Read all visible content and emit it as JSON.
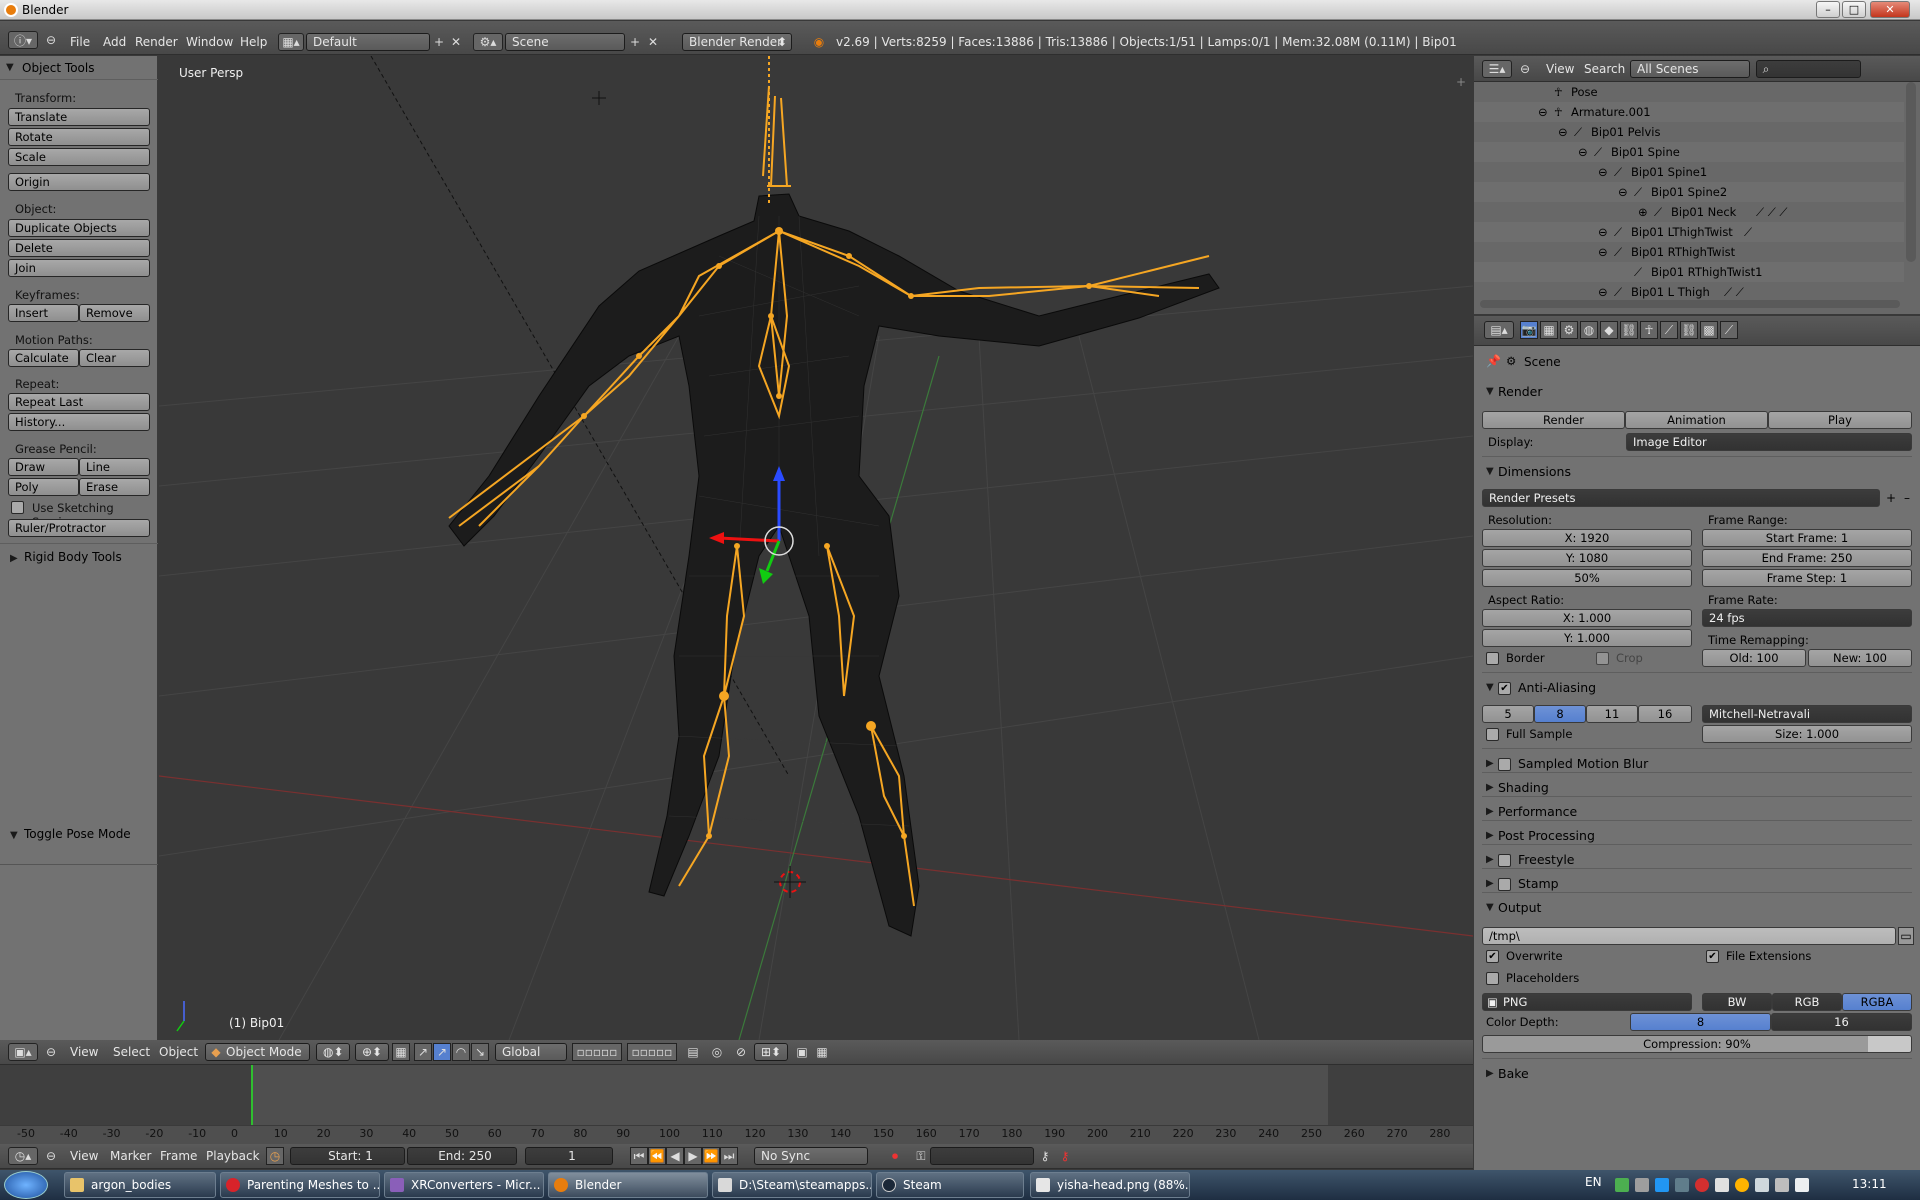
{
  "window": {
    "title": "Blender"
  },
  "info_header": {
    "menus": [
      "File",
      "Add",
      "Render",
      "Window",
      "Help"
    ],
    "screen_layout": "Default",
    "scene": "Scene",
    "render_engine": "Blender Render",
    "stats": "v2.69 | Verts:8259 | Faces:13886 | Tris:13886 | Objects:1/51 | Lamps:0/1 | Mem:32.08M (0.11M) | Bip01"
  },
  "tool_shelf": {
    "title": "Object Tools",
    "transform_label": "Transform:",
    "translate": "Translate",
    "rotate": "Rotate",
    "scale": "Scale",
    "origin": "Origin",
    "object_label": "Object:",
    "duplicate": "Duplicate Objects",
    "delete": "Delete",
    "join": "Join",
    "keyframes_label": "Keyframes:",
    "insert": "Insert",
    "remove": "Remove",
    "motion_paths_label": "Motion Paths:",
    "calculate": "Calculate",
    "clear": "Clear",
    "repeat_label": "Repeat:",
    "repeat_last": "Repeat Last",
    "history": "History...",
    "grease_label": "Grease Pencil:",
    "draw": "Draw",
    "line": "Line",
    "poly": "Poly",
    "erase": "Erase",
    "sketching": "Use Sketching Sessions",
    "ruler": "Ruler/Protractor",
    "rigid_body": "Rigid Body Tools",
    "toggle_pose": "Toggle Pose Mode"
  },
  "viewport": {
    "label": "User Persp",
    "active_object": "(1) Bip01"
  },
  "view3d_header": {
    "menus": [
      "View",
      "Select",
      "Object"
    ],
    "mode": "Object Mode",
    "orientation": "Global"
  },
  "outliner": {
    "menus": [
      "View",
      "Search"
    ],
    "filter": "All Scenes",
    "rows": [
      "Pose",
      "Armature.001",
      "Bip01 Pelvis",
      "Bip01 Spine",
      "Bip01 Spine1",
      "Bip01 Spine2",
      "Bip01 Neck",
      "Bip01 LThighTwist",
      "Bip01 RThighTwist",
      "Bip01 RThighTwist1",
      "Bip01 L Thigh"
    ]
  },
  "properties": {
    "context": "Scene",
    "render_panel": "Render",
    "render_btn": "Render",
    "animation_btn": "Animation",
    "play_btn": "Play",
    "display_label": "Display:",
    "display_value": "Image Editor",
    "dimensions": "Dimensions",
    "render_presets": "Render Presets",
    "resolution_label": "Resolution:",
    "res_x": "X: 1920",
    "res_y": "Y: 1080",
    "res_pct": "50%",
    "frame_range_label": "Frame Range:",
    "start_frame": "Start Frame: 1",
    "end_frame": "End Frame: 250",
    "frame_step": "Frame Step: 1",
    "aspect_label": "Aspect Ratio:",
    "aspect_x": "X: 1.000",
    "aspect_y": "Y: 1.000",
    "frame_rate_label": "Frame Rate:",
    "frame_rate": "24 fps",
    "time_remap_label": "Time Remapping:",
    "old": "Old: 100",
    "new": "New: 100",
    "border": "Border",
    "crop": "Crop",
    "anti_aliasing": "Anti-Aliasing",
    "aa_samples": [
      "5",
      "8",
      "11",
      "16"
    ],
    "aa_filter": "Mitchell-Netravali",
    "full_sample": "Full Sample",
    "size": "Size: 1.000",
    "collapsed": [
      "Sampled Motion Blur",
      "Shading",
      "Performance",
      "Post Processing",
      "Freestyle",
      "Stamp"
    ],
    "output": "Output",
    "output_path": "/tmp\\",
    "overwrite": "Overwrite",
    "file_ext": "File Extensions",
    "placeholders": "Placeholders",
    "format": "PNG",
    "bw": "BW",
    "rgb": "RGB",
    "rgba": "RGBA",
    "color_depth_label": "Color Depth:",
    "depth_8": "8",
    "depth_16": "16",
    "compression": "Compression: 90%",
    "bake": "Bake"
  },
  "timeline": {
    "ticks": [
      "-50",
      "-40",
      "-30",
      "-20",
      "-10",
      "0",
      "10",
      "20",
      "30",
      "40",
      "50",
      "60",
      "70",
      "80",
      "90",
      "100",
      "110",
      "120",
      "130",
      "140",
      "150",
      "160",
      "170",
      "180",
      "190",
      "200",
      "210",
      "220",
      "230",
      "240",
      "250",
      "260",
      "270",
      "280"
    ],
    "menus": [
      "View",
      "Marker",
      "Frame",
      "Playback"
    ],
    "start": "Start: 1",
    "end": "End: 250",
    "current": "1",
    "sync": "No Sync"
  },
  "taskbar": {
    "items": [
      "argon_bodies",
      "Parenting Meshes to ...",
      "XRConverters - Micr...",
      "Blender",
      "D:\\Steam\\steamapps...",
      "Steam",
      "yisha-head.png (88%..."
    ],
    "lang": "EN",
    "clock": "13:11"
  },
  "colors": {
    "accent": "#5680cf",
    "bone": "#f5a623",
    "viewport_bg": "#393939"
  }
}
